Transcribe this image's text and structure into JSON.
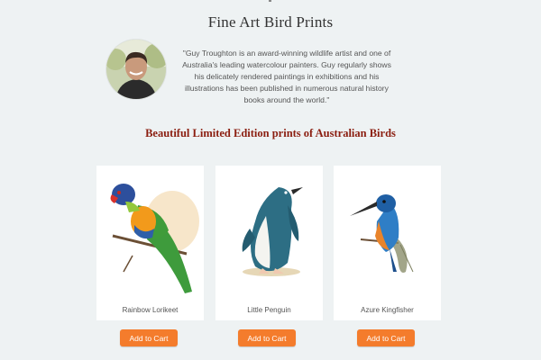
{
  "header": {
    "title": "Fine Art Bird Prints"
  },
  "artist": {
    "quote": "\"Guy Troughton is an award-winning wildlife artist and one of Australia's leading watercolour painters. Guy regularly shows his delicately rendered paintings in exhibitions and his illustrations has been published in numerous natural history books around the world.\""
  },
  "section": {
    "subtitle": "Beautiful Limited Edition prints of Australian Birds"
  },
  "products": [
    {
      "name": "Rainbow Lorikeet",
      "button": "Add to Cart"
    },
    {
      "name": "Little Penguin",
      "button": "Add to Cart"
    },
    {
      "name": "Azure Kingfisher",
      "button": "Add to Cart"
    }
  ],
  "colors": {
    "background": "#eef2f3",
    "subtitle": "#8b1e10",
    "button": "#f47c2c"
  }
}
